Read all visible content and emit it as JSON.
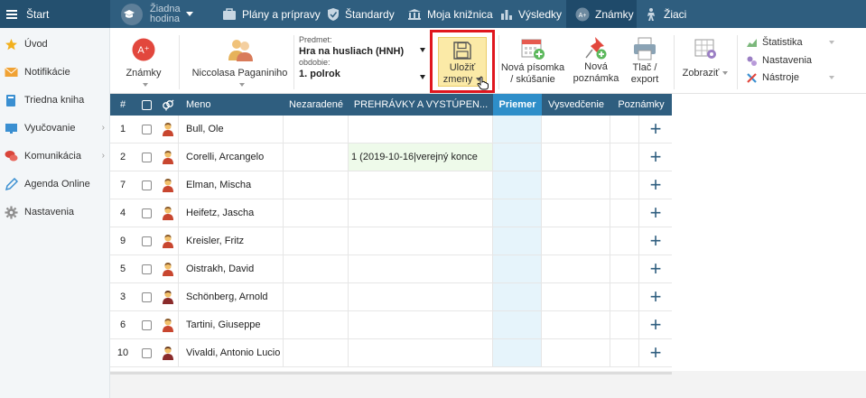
{
  "topbar": {
    "start_label": "Štart",
    "hodina_line1": "Žiadna",
    "hodina_line2": "hodina",
    "nav": [
      {
        "label": "Plány a prípravy",
        "icon": "briefcase-icon"
      },
      {
        "label": "Štandardy",
        "icon": "shield-icon"
      },
      {
        "label": "Moja knižnica",
        "icon": "library-icon"
      },
      {
        "label": "Výsledky",
        "icon": "bar-chart-icon"
      },
      {
        "label": "Známky",
        "icon": "grades-icon",
        "active": true
      },
      {
        "label": "Žiaci",
        "icon": "students-icon"
      }
    ]
  },
  "sidebar": {
    "items": [
      {
        "label": "Úvod",
        "icon": "star-icon",
        "color": "#f2b01e"
      },
      {
        "label": "Notifikácie",
        "icon": "envelope-icon",
        "color": "#f0a234"
      },
      {
        "label": "Triedna kniha",
        "icon": "book-icon",
        "color": "#3a8fd1"
      },
      {
        "label": "Vyučovanie",
        "icon": "teaching-icon",
        "color": "#3a8fd1",
        "arrow": "›"
      },
      {
        "label": "Komunikácia",
        "icon": "chat-icon",
        "color": "#d9453a",
        "arrow": "›"
      },
      {
        "label": "Agenda Online",
        "icon": "pen-icon",
        "color": "#3a8fd1"
      },
      {
        "label": "Nastavenia",
        "icon": "gear-icon",
        "color": "#8d8d8d"
      }
    ]
  },
  "ribbon": {
    "znamky_label": "Známky",
    "teacher_label": "Niccolasa Paganiniho",
    "subject_caption": "Predmet:",
    "subject_value": "Hra na husliach (HNH)",
    "period_caption": "obdobie:",
    "period_value": "1. polrok",
    "save_line1": "Uložiť",
    "save_line2": "zmeny",
    "new_test_line1": "Nová písomka",
    "new_test_line2": "/ skúšanie",
    "new_note_line1": "Nová",
    "new_note_line2": "poznámka",
    "print_line1": "Tlač /",
    "print_line2": "export",
    "view_label": "Zobraziť",
    "menu": [
      "Štatistika",
      "Nastavenia",
      "Nástroje"
    ]
  },
  "table": {
    "headers": {
      "num": "#",
      "name": "Meno",
      "unassigned": "Nezaradené",
      "performances": "PREHRÁVKY A VYSTÚPEN...",
      "average": "Priemer",
      "report": "Vysvedčenie",
      "notes": "Poznámky"
    },
    "rows": [
      {
        "num": "1",
        "name": "Bull, Ole",
        "grade": "",
        "gender": "male"
      },
      {
        "num": "2",
        "name": "Corelli, Arcangelo",
        "grade": "1 (2019-10-16|verejný konce",
        "gender": "male"
      },
      {
        "num": "7",
        "name": "Elman, Mischa",
        "grade": "",
        "gender": "male"
      },
      {
        "num": "4",
        "name": "Heifetz, Jascha",
        "grade": "",
        "gender": "male"
      },
      {
        "num": "9",
        "name": "Kreisler, Fritz",
        "grade": "",
        "gender": "male"
      },
      {
        "num": "5",
        "name": "Oistrakh, David",
        "grade": "",
        "gender": "male"
      },
      {
        "num": "3",
        "name": "Schönberg, Arnold",
        "grade": "",
        "gender": "male-dark"
      },
      {
        "num": "6",
        "name": "Tartini, Giuseppe",
        "grade": "",
        "gender": "male"
      },
      {
        "num": "10",
        "name": "Vivaldi, Antonio Lucio",
        "grade": "",
        "gender": "male-dark"
      }
    ],
    "add_symbol": "+"
  },
  "colors": {
    "topbar": "#2f5e7f",
    "average_header": "#2e8ec9",
    "save_highlight": "#e0161e"
  }
}
